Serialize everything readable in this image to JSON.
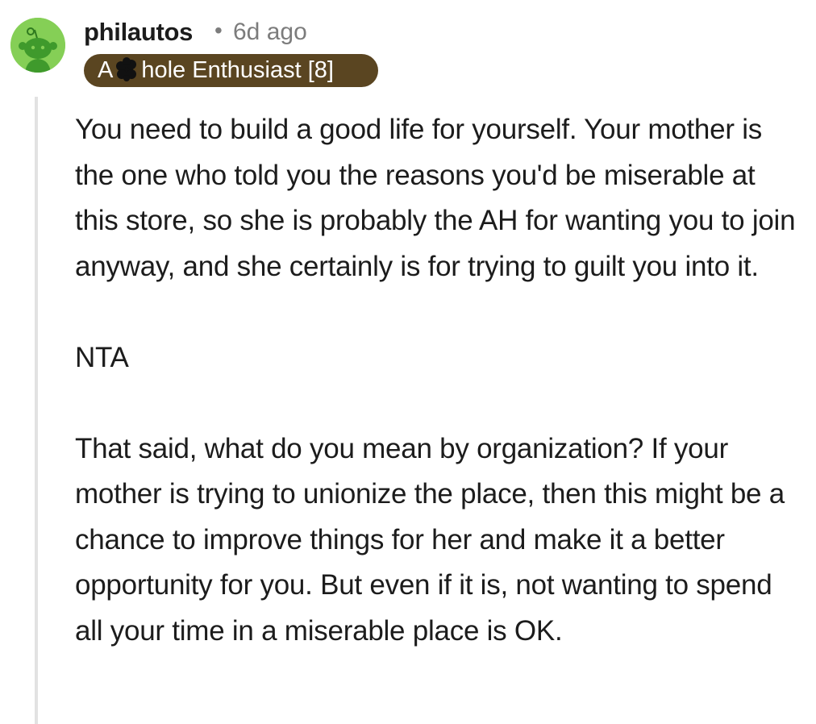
{
  "comment": {
    "avatar_icon": "snoo-avatar-icon",
    "avatar_color": "#85cf56",
    "username": "philautos",
    "separator": "•",
    "timestamp": "6d ago",
    "flair": {
      "text_start": "A",
      "text_end": "hole Enthusiast [8]",
      "censor_icon": "censor-blot-icon",
      "background": "#5a4521"
    },
    "paragraphs": [
      "You need to build a good life for yourself. Your mother is the one who told you the reasons you'd be miserable at this store, so she is probably the AH for wanting you to join anyway, and she certainly is for trying to guilt you into it.",
      "NTA",
      "That said, what do you mean by organization? If your mother is trying to unionize the place, then this might be a chance to improve things for her and make it a better opportunity for you. But even if it is, not wanting to spend all your time in a miserable place is OK."
    ]
  }
}
